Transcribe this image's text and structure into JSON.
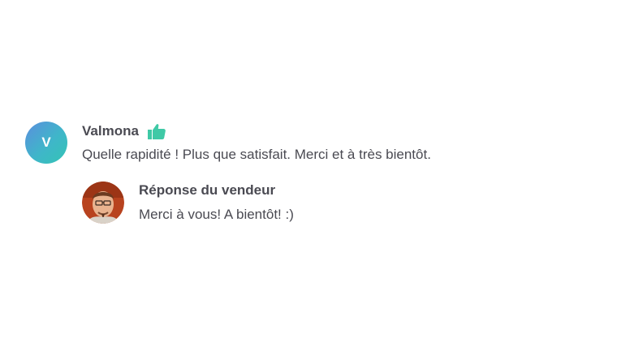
{
  "review": {
    "avatar_initial": "V",
    "author": "Valmona",
    "rating_icon": "thumbs-up-icon",
    "text": "Quelle rapidité ! Plus que satisfait. Merci et à très bientôt."
  },
  "reply": {
    "title": "Réponse du vendeur",
    "text": "Merci à vous! A bientôt! :)"
  },
  "colors": {
    "text": "#4a4a52",
    "thumb": "#3fc9a6",
    "avatar_gradient_start": "#5b8ede",
    "avatar_gradient_end": "#34c4b5"
  }
}
